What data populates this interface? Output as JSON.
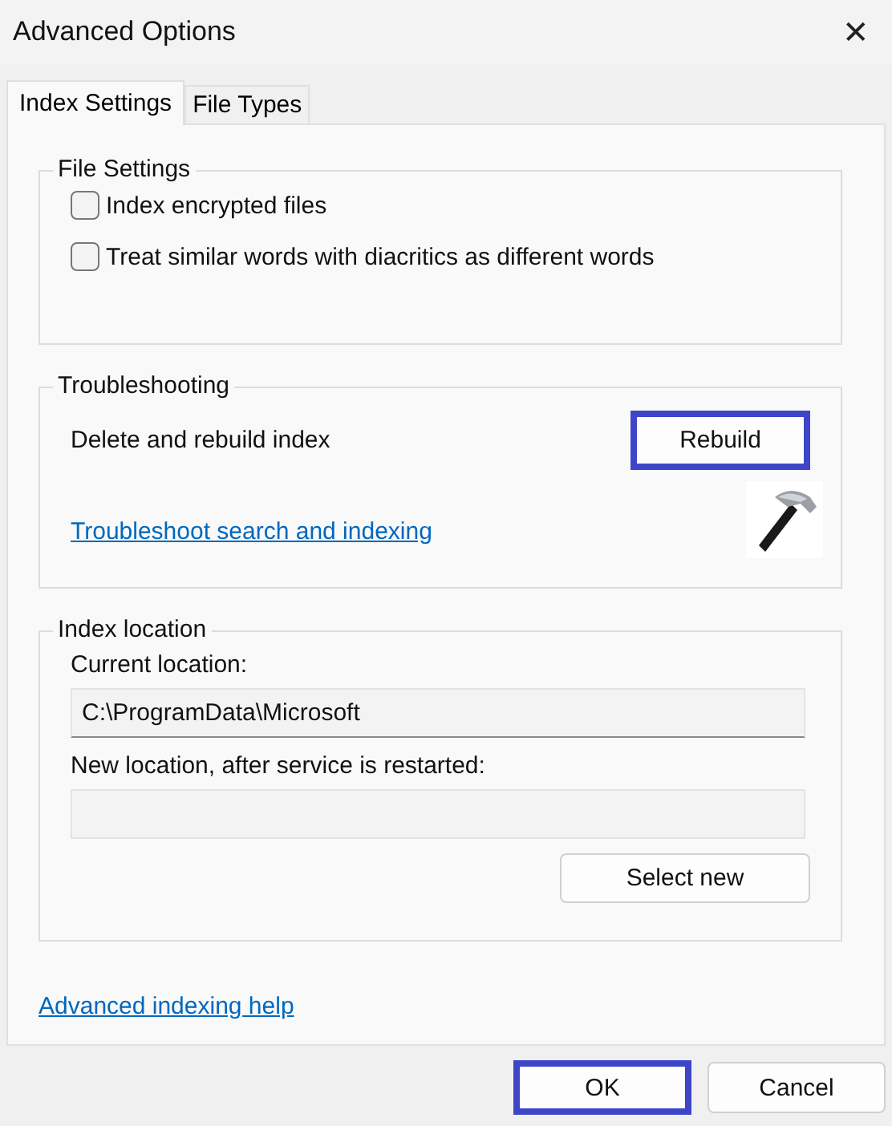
{
  "window": {
    "title": "Advanced Options",
    "close": "✕"
  },
  "tabs": [
    {
      "label": "Index Settings",
      "selected": true
    },
    {
      "label": "File Types",
      "selected": false
    }
  ],
  "file_settings": {
    "title": "File Settings",
    "options": [
      {
        "label": "Index encrypted files",
        "checked": false
      },
      {
        "label": "Treat similar words with diacritics as different words",
        "checked": false
      }
    ]
  },
  "troubleshooting": {
    "title": "Troubleshooting",
    "rebuild_label": "Delete and rebuild index",
    "rebuild_button": {
      "label": "Rebuild",
      "highlighted": true
    },
    "link": "Troubleshoot search and indexing"
  },
  "index_location": {
    "title": "Index location",
    "current_label": "Current location:",
    "current_value": "C:\\ProgramData\\Microsoft",
    "new_label": "New location, after service is restarted:",
    "select_button": {
      "label": "Select new",
      "highlighted": false
    }
  },
  "help_link": "Advanced indexing help",
  "buttons": [
    {
      "label": "OK",
      "highlighted": true
    },
    {
      "label": "Cancel",
      "highlighted": false
    }
  ]
}
